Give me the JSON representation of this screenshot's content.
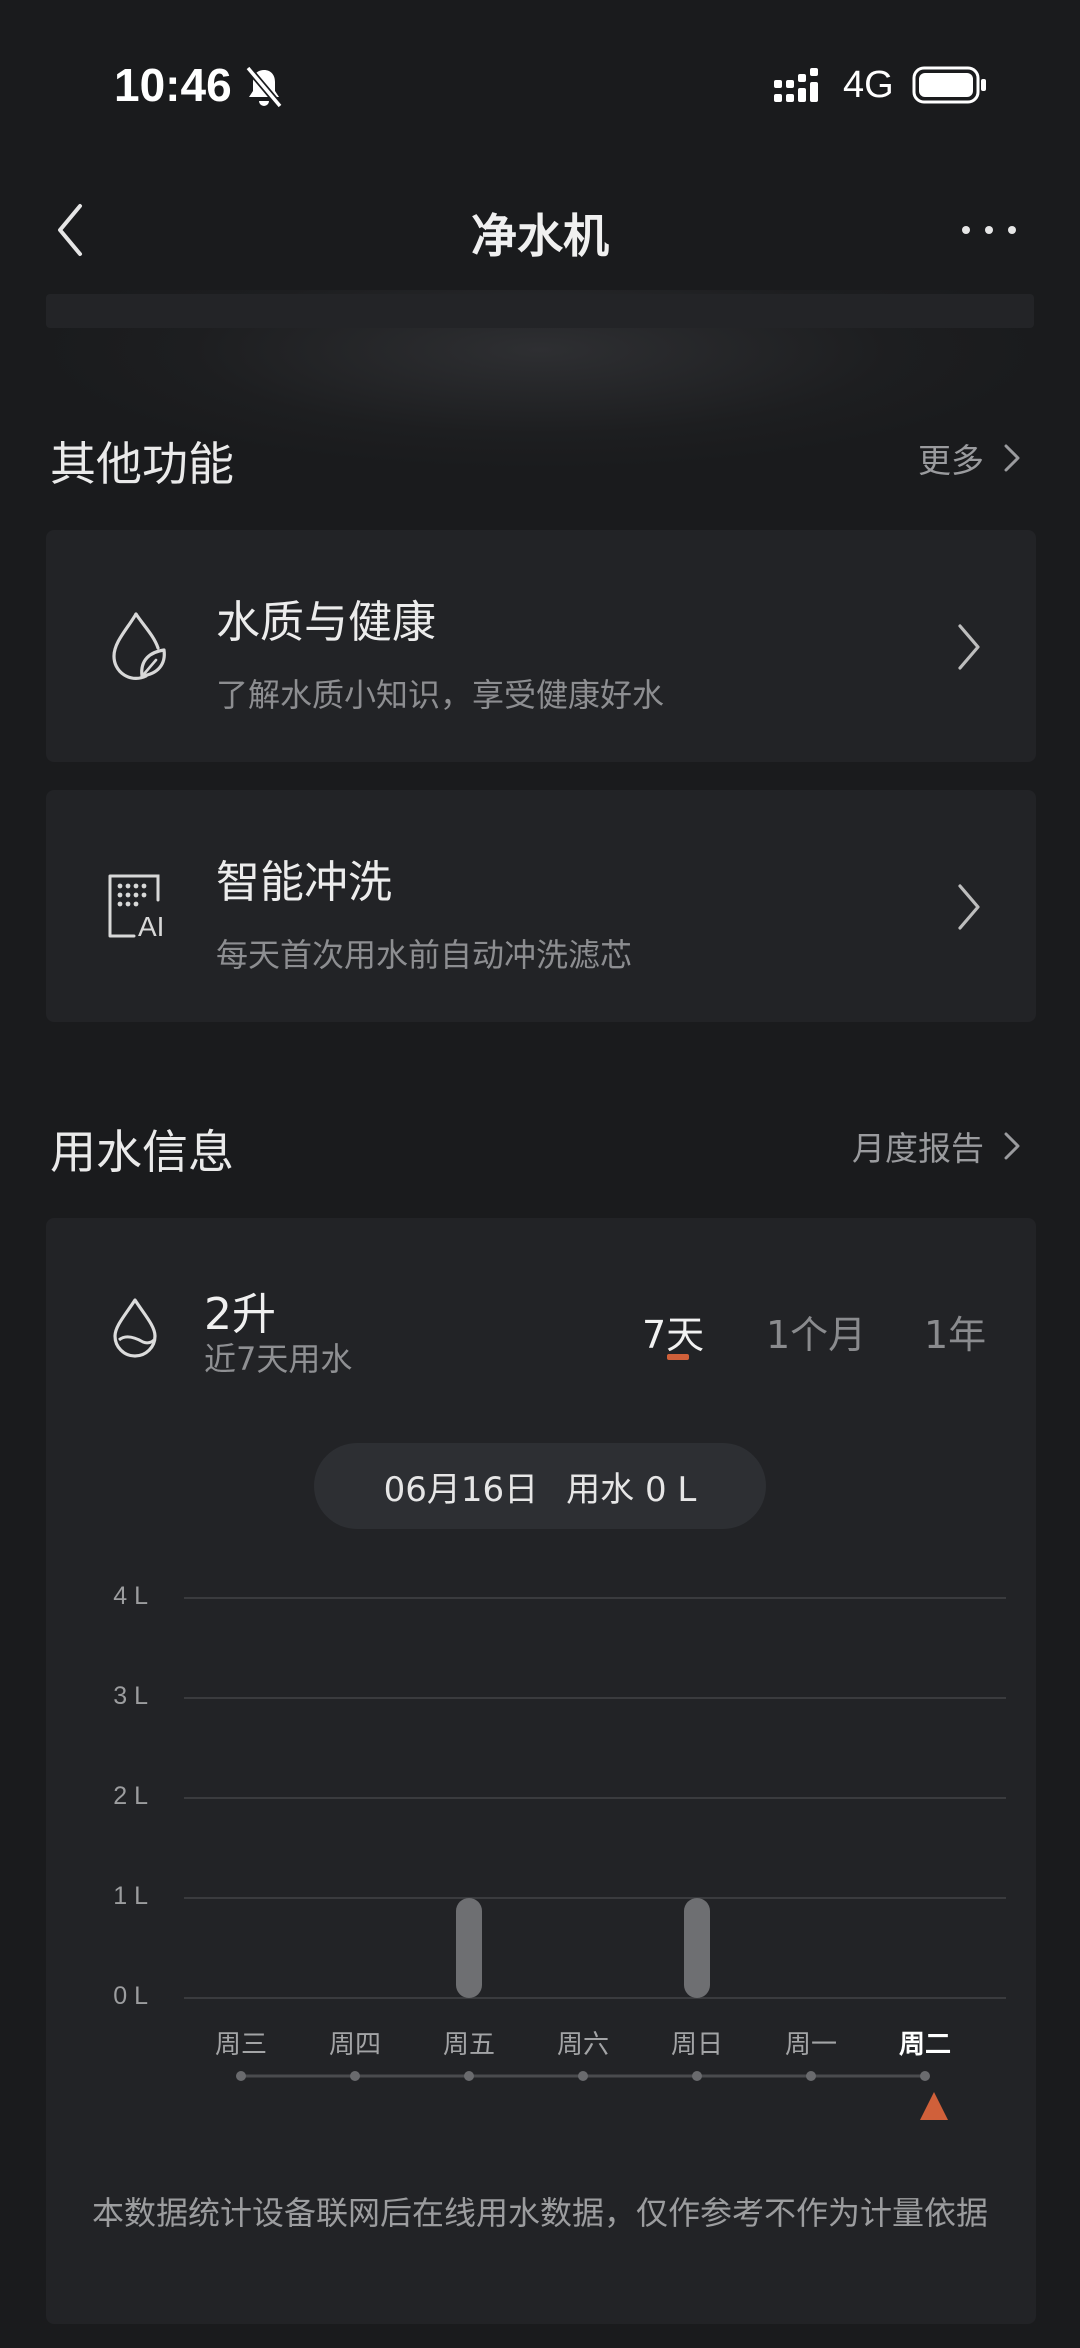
{
  "status_bar": {
    "time": "10:46",
    "network": "4G"
  },
  "nav": {
    "title": "净水机"
  },
  "other_functions": {
    "title": "其他功能",
    "more": "更多",
    "items": [
      {
        "title": "水质与健康",
        "subtitle": "了解水质小知识，享受健康好水",
        "icon": "water-leaf-icon"
      },
      {
        "title": "智能冲洗",
        "subtitle": "每天首次用水前自动冲洗滤芯",
        "icon": "ai-flush-icon"
      }
    ]
  },
  "water_info": {
    "title": "用水信息",
    "report": "月度报告",
    "total_value": "2升",
    "total_label": "近7天用水",
    "tabs": [
      "7天",
      "1个月",
      "1年"
    ],
    "active_tab": 0,
    "selected_date": "06月16日",
    "selected_usage": "用水 0 L",
    "note": "本数据统计设备联网后在线用水数据，仅作参考不作为计量依据"
  },
  "chart_data": {
    "type": "bar",
    "categories": [
      "周三",
      "周四",
      "周五",
      "周六",
      "周日",
      "周一",
      "周二"
    ],
    "values": [
      0,
      0,
      1,
      0,
      1,
      0,
      0
    ],
    "y_ticks": [
      "0 L",
      "1 L",
      "2 L",
      "3 L",
      "4 L"
    ],
    "ylim": [
      0,
      4
    ],
    "selected_index": 6,
    "grid": true,
    "colors": {
      "bar": "#6e6f72",
      "marker": "#d0603a",
      "grid": "#3a3b3e"
    }
  }
}
